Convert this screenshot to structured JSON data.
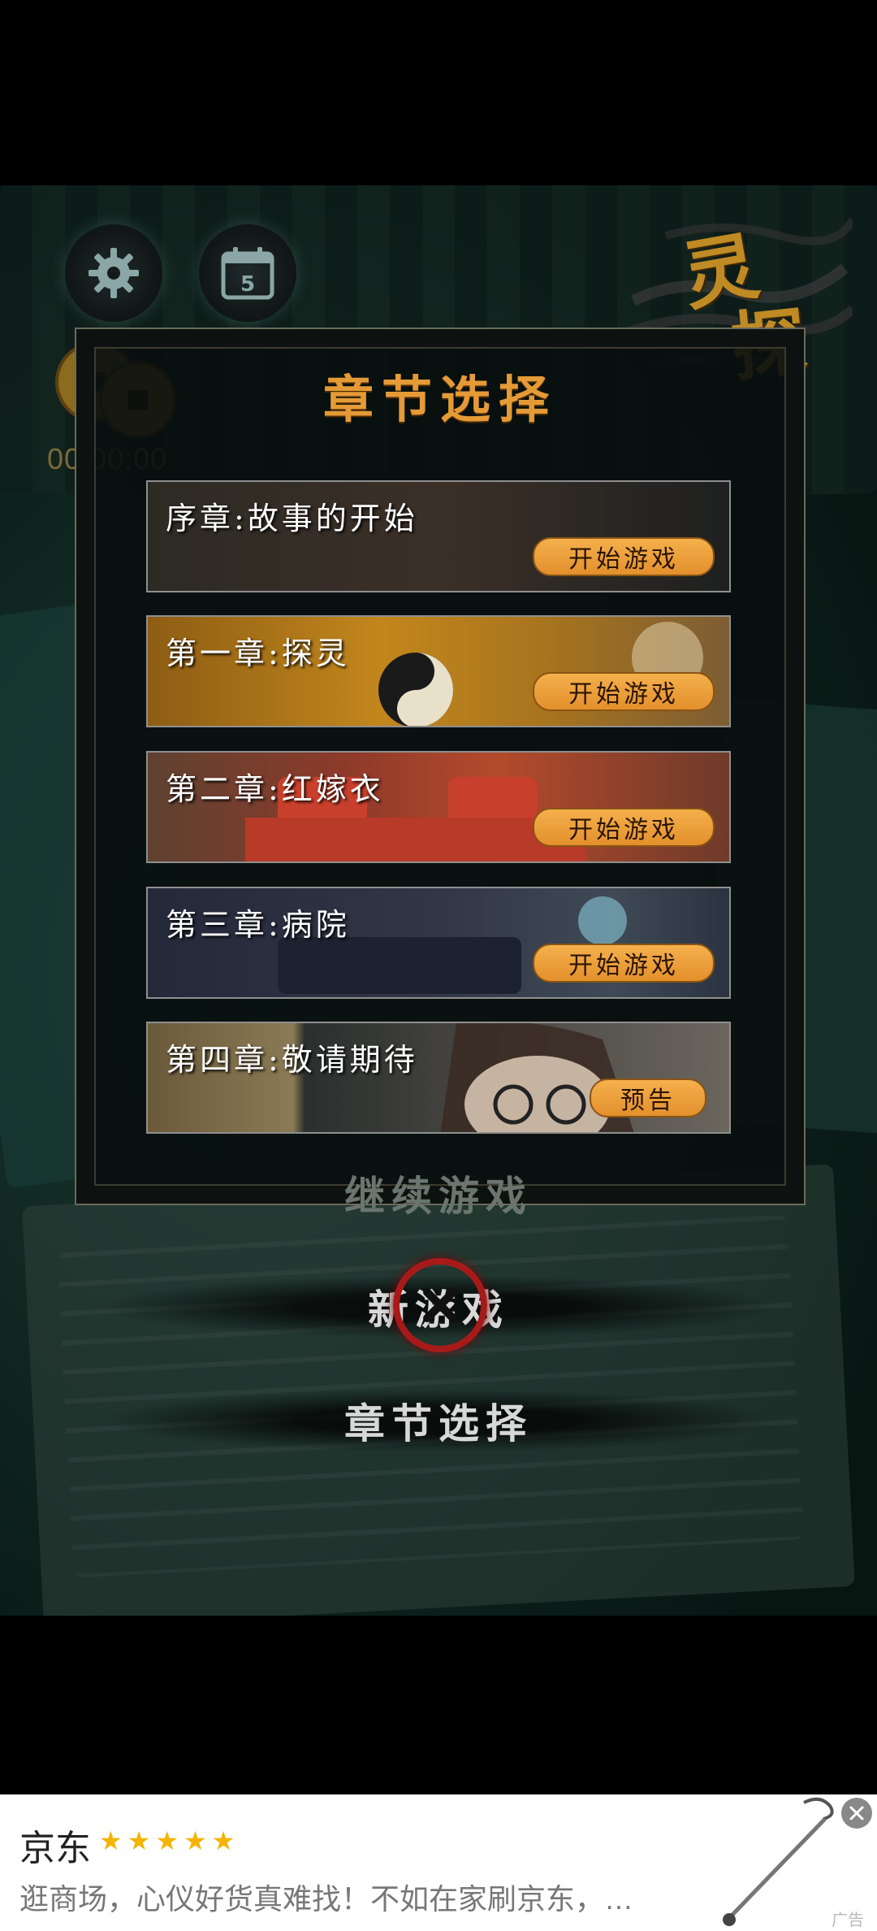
{
  "logo": {
    "chars": [
      "灵",
      "探"
    ]
  },
  "timer": "00:00:00",
  "calendar_day": "5",
  "panel_title": "章节选择",
  "chapters": [
    {
      "name": "序章:故事的开始",
      "button": "开始游戏"
    },
    {
      "name": "第一章:探灵",
      "button": "开始游戏"
    },
    {
      "name": "第二章:红嫁衣",
      "button": "开始游戏"
    },
    {
      "name": "第三章:病院",
      "button": "开始游戏"
    },
    {
      "name": "第四章:敬请期待",
      "button": "预告"
    }
  ],
  "menu": {
    "continue": "继续游戏",
    "new_game": "新游戏",
    "chapter_select": "章节选择"
  },
  "ad": {
    "title": "京东",
    "stars": "★★★★★",
    "description": "逛商场，心仪好货真难找！不如在家刷京东，…",
    "label": "广告"
  },
  "colors": {
    "accent": "#e49a36",
    "button": "#f0a640",
    "close_badge": "#a81a1a"
  }
}
